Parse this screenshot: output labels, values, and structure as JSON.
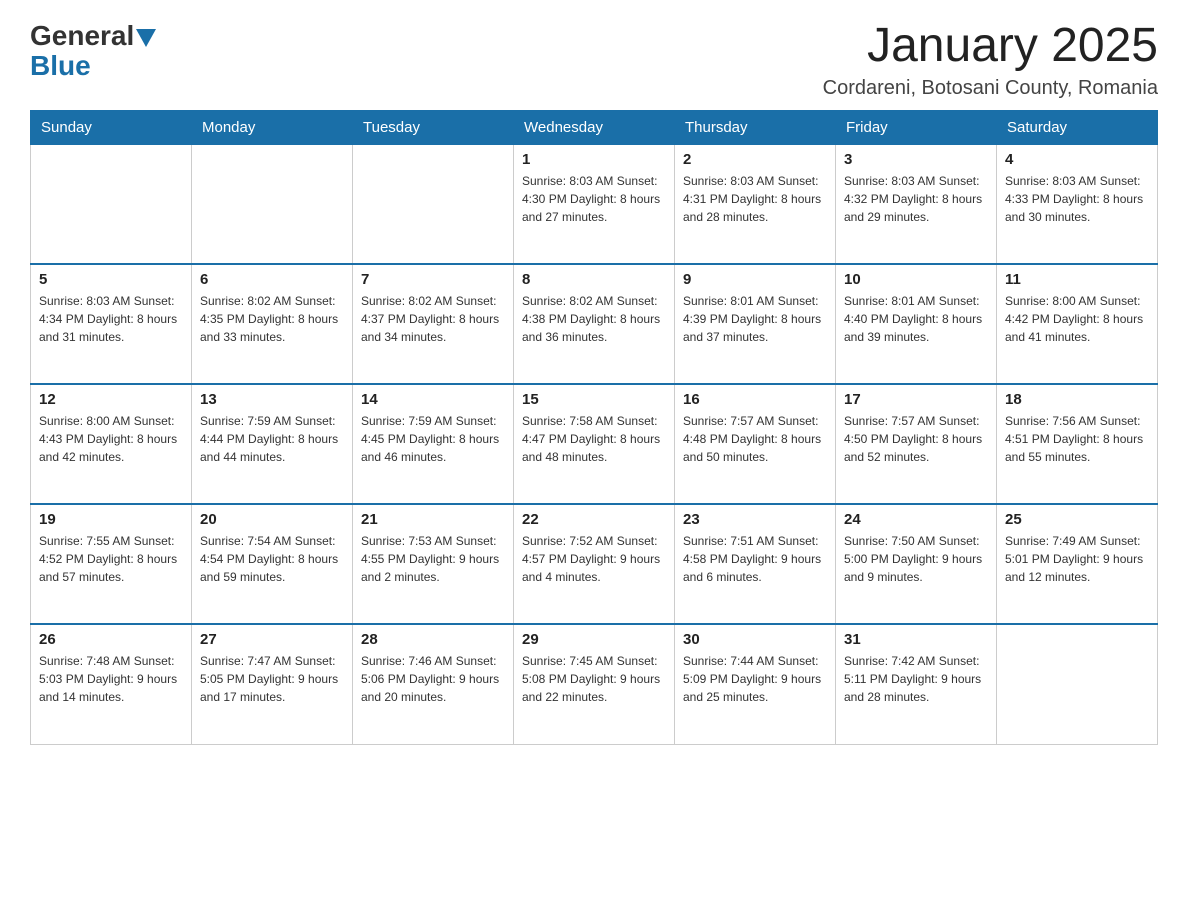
{
  "logo": {
    "general": "General",
    "blue": "Blue"
  },
  "header": {
    "month": "January 2025",
    "location": "Cordareni, Botosani County, Romania"
  },
  "weekdays": [
    "Sunday",
    "Monday",
    "Tuesday",
    "Wednesday",
    "Thursday",
    "Friday",
    "Saturday"
  ],
  "weeks": [
    [
      {
        "day": "",
        "info": ""
      },
      {
        "day": "",
        "info": ""
      },
      {
        "day": "",
        "info": ""
      },
      {
        "day": "1",
        "info": "Sunrise: 8:03 AM\nSunset: 4:30 PM\nDaylight: 8 hours\nand 27 minutes."
      },
      {
        "day": "2",
        "info": "Sunrise: 8:03 AM\nSunset: 4:31 PM\nDaylight: 8 hours\nand 28 minutes."
      },
      {
        "day": "3",
        "info": "Sunrise: 8:03 AM\nSunset: 4:32 PM\nDaylight: 8 hours\nand 29 minutes."
      },
      {
        "day": "4",
        "info": "Sunrise: 8:03 AM\nSunset: 4:33 PM\nDaylight: 8 hours\nand 30 minutes."
      }
    ],
    [
      {
        "day": "5",
        "info": "Sunrise: 8:03 AM\nSunset: 4:34 PM\nDaylight: 8 hours\nand 31 minutes."
      },
      {
        "day": "6",
        "info": "Sunrise: 8:02 AM\nSunset: 4:35 PM\nDaylight: 8 hours\nand 33 minutes."
      },
      {
        "day": "7",
        "info": "Sunrise: 8:02 AM\nSunset: 4:37 PM\nDaylight: 8 hours\nand 34 minutes."
      },
      {
        "day": "8",
        "info": "Sunrise: 8:02 AM\nSunset: 4:38 PM\nDaylight: 8 hours\nand 36 minutes."
      },
      {
        "day": "9",
        "info": "Sunrise: 8:01 AM\nSunset: 4:39 PM\nDaylight: 8 hours\nand 37 minutes."
      },
      {
        "day": "10",
        "info": "Sunrise: 8:01 AM\nSunset: 4:40 PM\nDaylight: 8 hours\nand 39 minutes."
      },
      {
        "day": "11",
        "info": "Sunrise: 8:00 AM\nSunset: 4:42 PM\nDaylight: 8 hours\nand 41 minutes."
      }
    ],
    [
      {
        "day": "12",
        "info": "Sunrise: 8:00 AM\nSunset: 4:43 PM\nDaylight: 8 hours\nand 42 minutes."
      },
      {
        "day": "13",
        "info": "Sunrise: 7:59 AM\nSunset: 4:44 PM\nDaylight: 8 hours\nand 44 minutes."
      },
      {
        "day": "14",
        "info": "Sunrise: 7:59 AM\nSunset: 4:45 PM\nDaylight: 8 hours\nand 46 minutes."
      },
      {
        "day": "15",
        "info": "Sunrise: 7:58 AM\nSunset: 4:47 PM\nDaylight: 8 hours\nand 48 minutes."
      },
      {
        "day": "16",
        "info": "Sunrise: 7:57 AM\nSunset: 4:48 PM\nDaylight: 8 hours\nand 50 minutes."
      },
      {
        "day": "17",
        "info": "Sunrise: 7:57 AM\nSunset: 4:50 PM\nDaylight: 8 hours\nand 52 minutes."
      },
      {
        "day": "18",
        "info": "Sunrise: 7:56 AM\nSunset: 4:51 PM\nDaylight: 8 hours\nand 55 minutes."
      }
    ],
    [
      {
        "day": "19",
        "info": "Sunrise: 7:55 AM\nSunset: 4:52 PM\nDaylight: 8 hours\nand 57 minutes."
      },
      {
        "day": "20",
        "info": "Sunrise: 7:54 AM\nSunset: 4:54 PM\nDaylight: 8 hours\nand 59 minutes."
      },
      {
        "day": "21",
        "info": "Sunrise: 7:53 AM\nSunset: 4:55 PM\nDaylight: 9 hours\nand 2 minutes."
      },
      {
        "day": "22",
        "info": "Sunrise: 7:52 AM\nSunset: 4:57 PM\nDaylight: 9 hours\nand 4 minutes."
      },
      {
        "day": "23",
        "info": "Sunrise: 7:51 AM\nSunset: 4:58 PM\nDaylight: 9 hours\nand 6 minutes."
      },
      {
        "day": "24",
        "info": "Sunrise: 7:50 AM\nSunset: 5:00 PM\nDaylight: 9 hours\nand 9 minutes."
      },
      {
        "day": "25",
        "info": "Sunrise: 7:49 AM\nSunset: 5:01 PM\nDaylight: 9 hours\nand 12 minutes."
      }
    ],
    [
      {
        "day": "26",
        "info": "Sunrise: 7:48 AM\nSunset: 5:03 PM\nDaylight: 9 hours\nand 14 minutes."
      },
      {
        "day": "27",
        "info": "Sunrise: 7:47 AM\nSunset: 5:05 PM\nDaylight: 9 hours\nand 17 minutes."
      },
      {
        "day": "28",
        "info": "Sunrise: 7:46 AM\nSunset: 5:06 PM\nDaylight: 9 hours\nand 20 minutes."
      },
      {
        "day": "29",
        "info": "Sunrise: 7:45 AM\nSunset: 5:08 PM\nDaylight: 9 hours\nand 22 minutes."
      },
      {
        "day": "30",
        "info": "Sunrise: 7:44 AM\nSunset: 5:09 PM\nDaylight: 9 hours\nand 25 minutes."
      },
      {
        "day": "31",
        "info": "Sunrise: 7:42 AM\nSunset: 5:11 PM\nDaylight: 9 hours\nand 28 minutes."
      },
      {
        "day": "",
        "info": ""
      }
    ]
  ]
}
